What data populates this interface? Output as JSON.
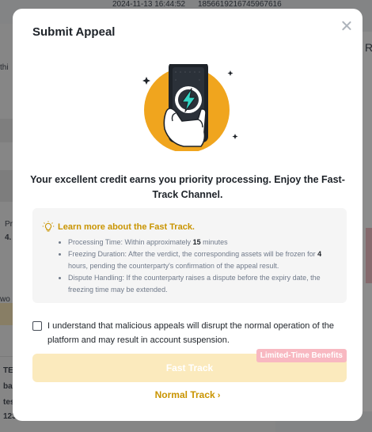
{
  "background": {
    "timestamp": "2024-11-13 16:44:52",
    "order_id": "1856619216745967616",
    "fragments": {
      "left_1": "thi",
      "left_2": "Pr",
      "left_3": "4.",
      "left_4": "wo",
      "left_5": "TE",
      "left_6": "ba",
      "left_7": "tes",
      "left_8": "123",
      "right_1": "Ra"
    }
  },
  "modal": {
    "title": "Submit Appeal",
    "headline": "Your excellent credit earns you priority processing. Enjoy the Fast-Track Channel.",
    "info": {
      "title": "Learn more about the Fast Track.",
      "items": [
        {
          "pre": "Processing Time: Within approximately ",
          "bold": "15",
          "post": " minutes"
        },
        {
          "pre": "Freezing Duration: After the verdict, the corresponding assets will be frozen for ",
          "bold": "4",
          "post": " hours, pending the counterparty's confirmation of the appeal result."
        },
        {
          "pre": "Dispute Handling: If the counterparty raises a dispute before the expiry date, the freezing time may be extended.",
          "bold": "",
          "post": ""
        }
      ]
    },
    "agreement": "I understand that malicious appeals will disrupt the normal operation of the platform and may result in account suspension.",
    "fast_track_label": "Fast Track",
    "badge": "Limited-Time Benefits",
    "normal_track_label": "Normal Track",
    "chevron": "›"
  },
  "colors": {
    "accent": "#c99400",
    "button_disabled": "#fbeabd",
    "badge": "#f8b8c1",
    "illustration_orange": "#f0a51e"
  },
  "icons": [
    "close-icon",
    "lightning-phone-illustration",
    "lightbulb-icon",
    "chevron-right-icon"
  ]
}
